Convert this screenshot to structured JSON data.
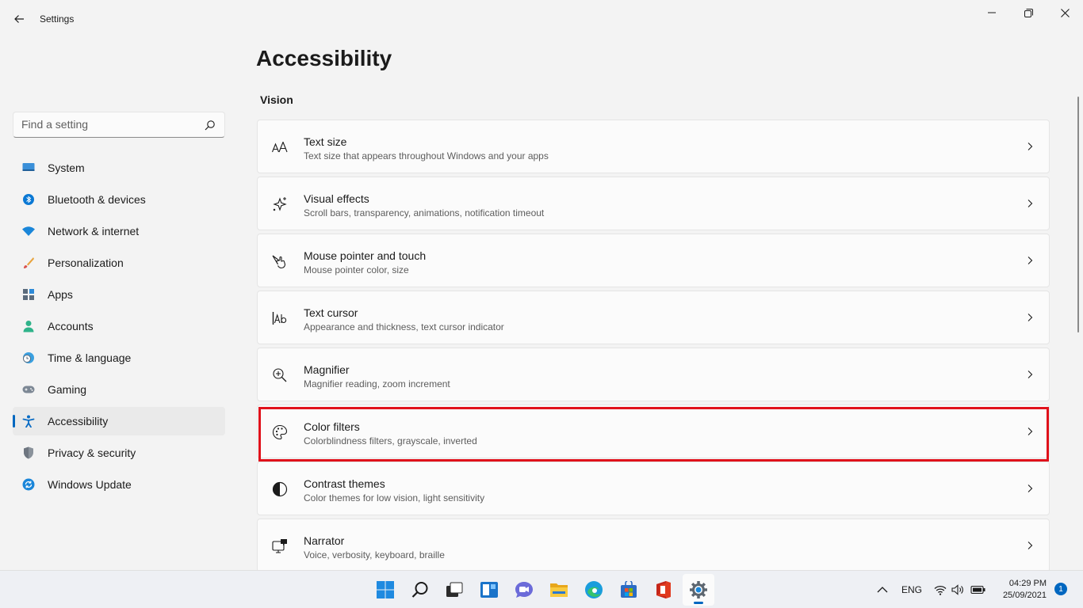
{
  "window": {
    "title": "Settings",
    "back_icon": "back-arrow-icon",
    "controls": [
      "minimize-icon",
      "maximize-icon",
      "close-icon"
    ]
  },
  "sidebar": {
    "search": {
      "placeholder": "Find a setting",
      "value": ""
    },
    "items": [
      {
        "label": "System",
        "icon": "system-icon",
        "active": false
      },
      {
        "label": "Bluetooth & devices",
        "icon": "bluetooth-icon",
        "active": false
      },
      {
        "label": "Network & internet",
        "icon": "wifi-icon",
        "active": false
      },
      {
        "label": "Personalization",
        "icon": "brush-icon",
        "active": false
      },
      {
        "label": "Apps",
        "icon": "apps-icon",
        "active": false
      },
      {
        "label": "Accounts",
        "icon": "person-icon",
        "active": false
      },
      {
        "label": "Time & language",
        "icon": "globe-clock-icon",
        "active": false
      },
      {
        "label": "Gaming",
        "icon": "gamepad-icon",
        "active": false
      },
      {
        "label": "Accessibility",
        "icon": "accessibility-icon",
        "active": true
      },
      {
        "label": "Privacy & security",
        "icon": "shield-icon",
        "active": false
      },
      {
        "label": "Windows Update",
        "icon": "update-icon",
        "active": false
      }
    ]
  },
  "main": {
    "title": "Accessibility",
    "section": "Vision",
    "cards": [
      {
        "title": "Text size",
        "desc": "Text size that appears throughout Windows and your apps",
        "icon": "text-size-icon"
      },
      {
        "title": "Visual effects",
        "desc": "Scroll bars, transparency, animations, notification timeout",
        "icon": "sparkle-icon"
      },
      {
        "title": "Mouse pointer and touch",
        "desc": "Mouse pointer color, size",
        "icon": "pointer-touch-icon"
      },
      {
        "title": "Text cursor",
        "desc": "Appearance and thickness, text cursor indicator",
        "icon": "text-cursor-icon"
      },
      {
        "title": "Magnifier",
        "desc": "Magnifier reading, zoom increment",
        "icon": "magnifier-icon"
      },
      {
        "title": "Color filters",
        "desc": "Colorblindness filters, grayscale, inverted",
        "icon": "palette-icon",
        "highlighted": true
      },
      {
        "title": "Contrast themes",
        "desc": "Color themes for low vision, light sensitivity",
        "icon": "contrast-icon"
      },
      {
        "title": "Narrator",
        "desc": "Voice, verbosity, keyboard, braille",
        "icon": "narrator-icon"
      }
    ]
  },
  "taskbar": {
    "apps": [
      "start-icon",
      "search-icon",
      "task-view-icon",
      "widgets-icon",
      "chat-icon",
      "file-explorer-icon",
      "edge-icon",
      "store-icon",
      "office-icon",
      "settings-icon"
    ],
    "active_app": "settings-icon",
    "tray": {
      "language": "ENG",
      "time": "04:29 PM",
      "date": "25/09/2021",
      "notifications": "1"
    }
  },
  "colors": {
    "accent": "#0067c0",
    "highlight": "#e0111b",
    "background": "#f3f3f3",
    "card": "#fbfbfb"
  }
}
